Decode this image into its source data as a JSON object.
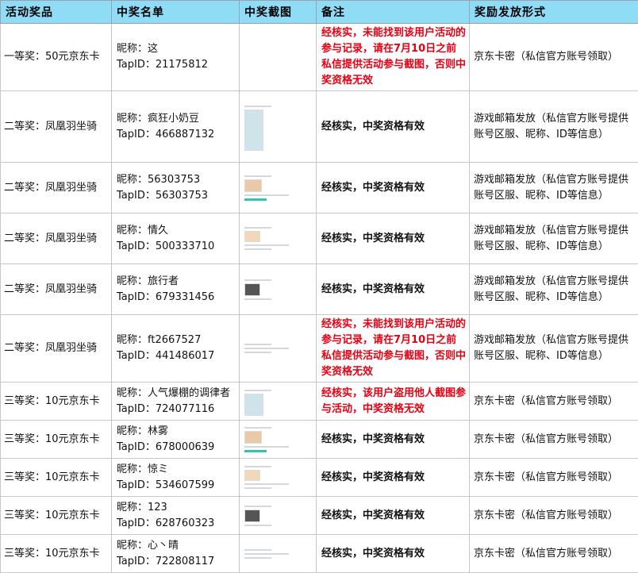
{
  "headers": [
    "活动奖品",
    "中奖名单",
    "中奖截图",
    "备注",
    "奖励发放形式"
  ],
  "rows": [
    {
      "prize": "一等奖：50元京东卡",
      "nickname": "昵称：这",
      "tapid": "TapID：21175812",
      "note": "经核实，未能找到该用户活动的参与记录，请在7月10日之前私信提供活动参与截图，否则中奖资格无效",
      "note_color": "red",
      "method": "京东卡密（私信官方账号领取）"
    },
    {
      "prize": "二等奖：凤凰羽坐骑",
      "nickname": "昵称：疯狂小奶豆",
      "tapid": "TapID：466887132",
      "note": "经核实，中奖资格有效",
      "note_color": "black",
      "method": "游戏邮箱发放（私信官方账号提供账号区服、昵称、ID等信息）"
    },
    {
      "prize": "二等奖：凤凰羽坐骑",
      "nickname": "昵称：56303753",
      "tapid": "TapID：56303753",
      "note": "经核实，中奖资格有效",
      "note_color": "black",
      "method": "游戏邮箱发放（私信官方账号提供账号区服、昵称、ID等信息）"
    },
    {
      "prize": "二等奖：凤凰羽坐骑",
      "nickname": "昵称：情久",
      "tapid": "TapID：500333710",
      "note": "经核实，中奖资格有效",
      "note_color": "black",
      "method": "游戏邮箱发放（私信官方账号提供账号区服、昵称、ID等信息）"
    },
    {
      "prize": "二等奖：凤凰羽坐骑",
      "nickname": "昵称：旅行者",
      "tapid": "TapID：679331456",
      "note": "经核实，中奖资格有效",
      "note_color": "black",
      "method": "游戏邮箱发放（私信官方账号提供账号区服、昵称、ID等信息）"
    },
    {
      "prize": "二等奖：凤凰羽坐骑",
      "nickname": "昵称：ft2667527",
      "tapid": "TapID：441486017",
      "note": "经核实，未能找到该用户活动的参与记录，请在7月10日之前私信提供活动参与截图，否则中奖资格无效",
      "note_color": "red",
      "method": "游戏邮箱发放（私信官方账号提供账号区服、昵称、ID等信息）"
    },
    {
      "prize": "三等奖：10元京东卡",
      "nickname": "昵称：人气爆棚的调律者",
      "tapid": "TapID：724077116",
      "note": "经核实，该用户盗用他人截图参与活动，中奖资格无效",
      "note_color": "red",
      "method": "京东卡密（私信官方账号领取）"
    },
    {
      "prize": "三等奖：10元京东卡",
      "nickname": "昵称：林雾",
      "tapid": "TapID：678000639",
      "note": "经核实，中奖资格有效",
      "note_color": "black",
      "method": "京东卡密（私信官方账号领取）"
    },
    {
      "prize": "三等奖：10元京东卡",
      "nickname": "昵称：惊ミ",
      "tapid": "TapID：534607599",
      "note": "经核实，中奖资格有效",
      "note_color": "black",
      "method": "京东卡密（私信官方账号领取）"
    },
    {
      "prize": "三等奖：10元京东卡",
      "nickname": "昵称：123",
      "tapid": "TapID：628760323",
      "note": "经核实，中奖资格有效",
      "note_color": "black",
      "method": "京东卡密（私信官方账号领取）"
    },
    {
      "prize": "三等奖：10元京东卡",
      "nickname": "昵称：心丶晴",
      "tapid": "TapID：722808117",
      "note": "经核实，中奖资格有效",
      "note_color": "black",
      "method": "京东卡密（私信官方账号领取）"
    }
  ],
  "colors": {
    "header_bg": "#8fdcf7",
    "note_red": "#e60012"
  },
  "screenshot_icon": "screenshot-thumbnail"
}
